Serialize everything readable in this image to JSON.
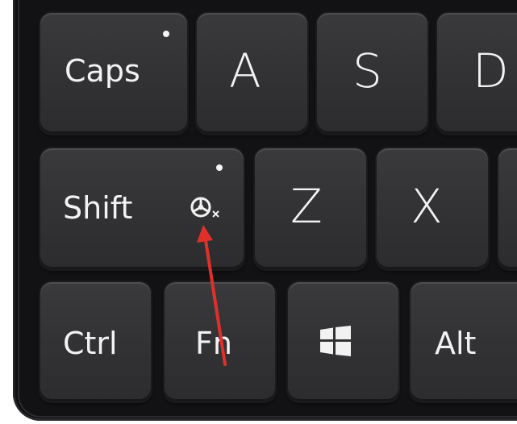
{
  "keyboard": {
    "rows": [
      {
        "keys": [
          {
            "name": "key-caps",
            "label": "Caps",
            "indicator": true
          },
          {
            "name": "key-a",
            "label": "A"
          },
          {
            "name": "key-s",
            "label": "S"
          },
          {
            "name": "key-d",
            "label": "D"
          }
        ]
      },
      {
        "keys": [
          {
            "name": "key-shift",
            "label": "Shift",
            "indicator": true,
            "icon": "wheel-off-icon"
          },
          {
            "name": "key-z",
            "label": "Z"
          },
          {
            "name": "key-x",
            "label": "X"
          }
        ]
      },
      {
        "keys": [
          {
            "name": "key-ctrl",
            "label": "Ctrl"
          },
          {
            "name": "key-fn",
            "label": "Fn"
          },
          {
            "name": "key-windows",
            "icon": "windows-logo-icon"
          },
          {
            "name": "key-alt",
            "label": "Alt"
          }
        ]
      }
    ]
  },
  "annotation": {
    "arrow_color": "#e0302b",
    "points_to": "wheel-off-icon"
  },
  "colors": {
    "deck": "#0f0f10",
    "keycap": "#333335",
    "legend": "#f2f2f2"
  }
}
